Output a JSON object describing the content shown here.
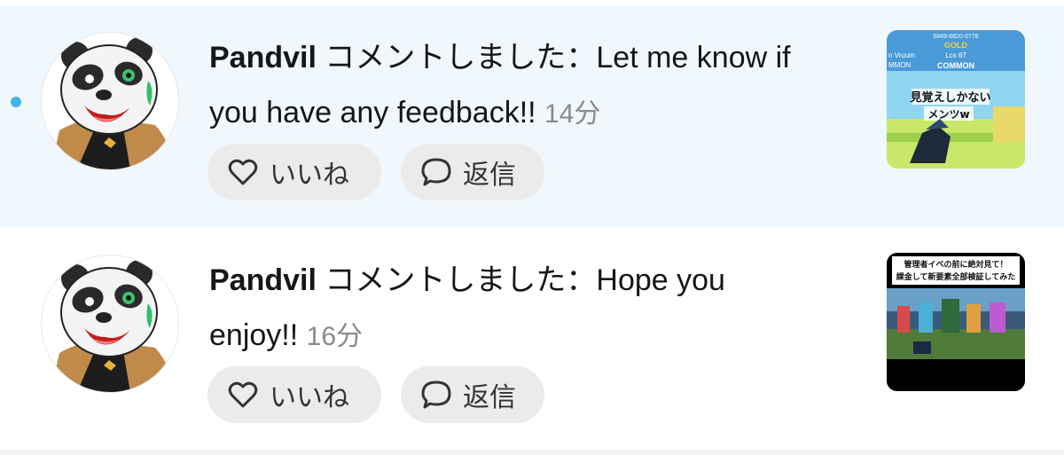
{
  "notifications": [
    {
      "username": "Pandvil",
      "action": " コメントしました：",
      "comment": "Let me know if you have any feedback!!",
      "time": "14分",
      "unread": true,
      "like_label": "いいね",
      "reply_label": "返信",
      "thumbnail": {
        "top_code": "5849-6820-0776",
        "rarity_top": "GOLD",
        "loss": "Lcs 67",
        "rarity": "COMMON",
        "left_name": "n Vruum",
        "left_rarity": "MMON",
        "caption_1": "見覚えしかない",
        "caption_2": "メンツw"
      }
    },
    {
      "username": "Pandvil",
      "action": " コメントしました：",
      "comment": "Hope you enjoy!!",
      "time": "16分",
      "unread": false,
      "like_label": "いいね",
      "reply_label": "返信",
      "thumbnail": {
        "caption_1": "管理者イベの前に絶対見て！",
        "caption_2": "課金して新要素全部検証してみた"
      }
    }
  ],
  "colors": {
    "unread_bg": "#f0f8fd",
    "unread_dot": "#3fb6e6",
    "button_bg": "#ebebeb",
    "time_text": "#8a8a8a"
  },
  "icons": {
    "like": "heart-outline-icon",
    "reply": "speech-bubble-icon"
  }
}
